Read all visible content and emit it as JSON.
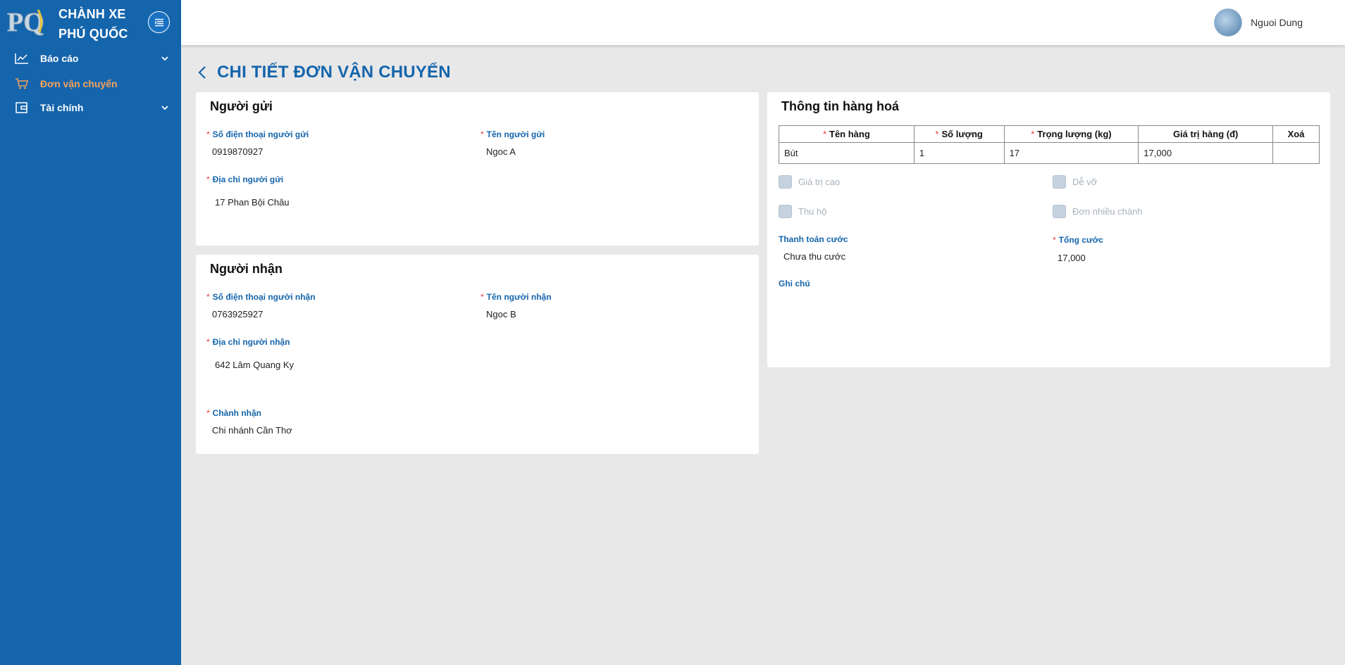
{
  "brand": {
    "logo_text": "PQ",
    "line1": "CHÀNH XE",
    "line2": "PHÚ QUỐC"
  },
  "sidebar": {
    "items": [
      {
        "label": "Báo cáo",
        "icon": "line-chart-icon",
        "expandable": true
      },
      {
        "label": "Đơn vận chuyển",
        "icon": "cart-icon",
        "active": true
      },
      {
        "label": "Tài chính",
        "icon": "wallet-icon",
        "expandable": true
      }
    ]
  },
  "header": {
    "user_name": "Nguoi Dung"
  },
  "page": {
    "title": "CHI TIẾT ĐƠN VẬN CHUYỂN"
  },
  "sender": {
    "title": "Người gửi",
    "phone_label": "Số điện thoại người gửi",
    "phone": "0919870927",
    "name_label": "Tên người gửi",
    "name": "Ngoc A",
    "address_label": "Địa chỉ người gửi",
    "address": "17 Phan Bội Châu"
  },
  "receiver": {
    "title": "Người nhận",
    "phone_label": "Số điện thoại người nhận",
    "phone": "0763925927",
    "name_label": "Tên người nhận",
    "name": "Ngoc B",
    "address_label": "Địa chỉ người nhận",
    "address": "642 Lâm Quang Ky",
    "branch_label": "Chành nhận",
    "branch": "Chi nhánh Cần Thơ"
  },
  "goods": {
    "title": "Thông tin hàng hoá",
    "columns": [
      "Tên hàng",
      "Số lượng",
      "Trọng lượng (kg)",
      "Giá trị hàng (đ)",
      "Xoá"
    ],
    "rows": [
      {
        "name": "Bút",
        "quantity": "1",
        "weight": "17",
        "value": "17,000",
        "delete": ""
      }
    ],
    "options": {
      "high_value": "Giá trị cao",
      "fragile": "Dễ vỡ",
      "cod": "Thu hộ",
      "multi_branch": "Đơn nhiều chành"
    },
    "payment_label": "Thanh toán cước",
    "payment": "Chưa thu cước",
    "total_label": "Tổng cước",
    "total": "17,000",
    "note_label": "Ghi chú"
  },
  "colors": {
    "primary": "#1565ac",
    "active_nav": "#f4a25a",
    "required": "#e53935",
    "background": "#e8e8e8"
  }
}
